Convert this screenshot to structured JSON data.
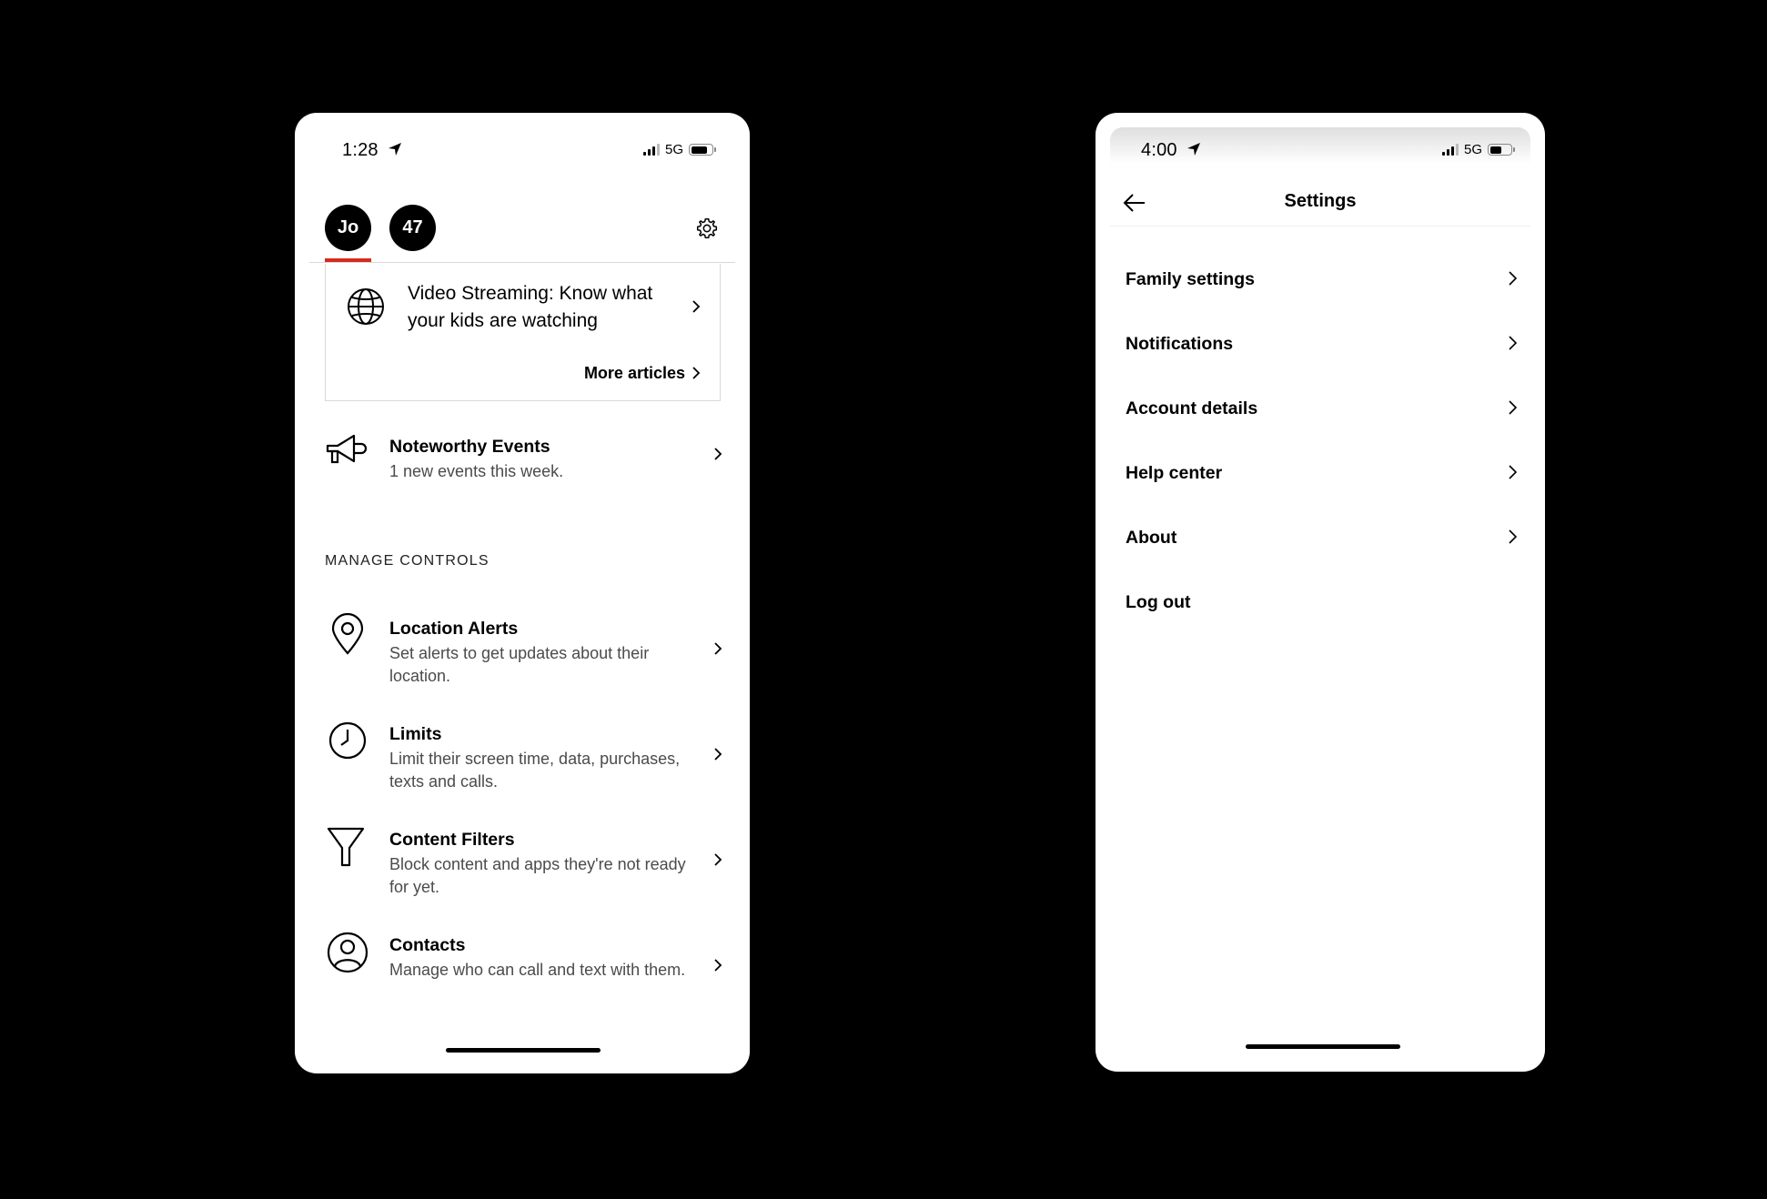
{
  "left_screen": {
    "status": {
      "time": "1:28",
      "network": "5G"
    },
    "profiles": [
      {
        "label": "Jo",
        "selected": true
      },
      {
        "label": "47",
        "selected": false
      }
    ],
    "article": {
      "title": "Video Streaming: Know what your kids are watching",
      "more_label": "More articles"
    },
    "noteworthy": {
      "title": "Noteworthy Events",
      "subtitle": "1 new events this week."
    },
    "section_label": "MANAGE CONTROLS",
    "controls": [
      {
        "icon": "location-pin-icon",
        "title": "Location Alerts",
        "subtitle": "Set alerts to get updates about their location."
      },
      {
        "icon": "clock-icon",
        "title": "Limits",
        "subtitle": "Limit their screen time, data, purchases, texts and calls."
      },
      {
        "icon": "funnel-icon",
        "title": "Content Filters",
        "subtitle": "Block content and apps they're not ready for yet."
      },
      {
        "icon": "contact-person-icon",
        "title": "Contacts",
        "subtitle": "Manage who can call and text with them."
      }
    ],
    "accent_color": "#d52b1e"
  },
  "right_screen": {
    "status": {
      "time": "4:00",
      "network": "5G"
    },
    "title": "Settings",
    "menu": [
      {
        "label": "Family settings",
        "has_chevron": true
      },
      {
        "label": "Notifications",
        "has_chevron": true
      },
      {
        "label": "Account details",
        "has_chevron": true
      },
      {
        "label": "Help center",
        "has_chevron": true
      },
      {
        "label": "About",
        "has_chevron": true
      },
      {
        "label": "Log out",
        "has_chevron": false
      }
    ]
  }
}
